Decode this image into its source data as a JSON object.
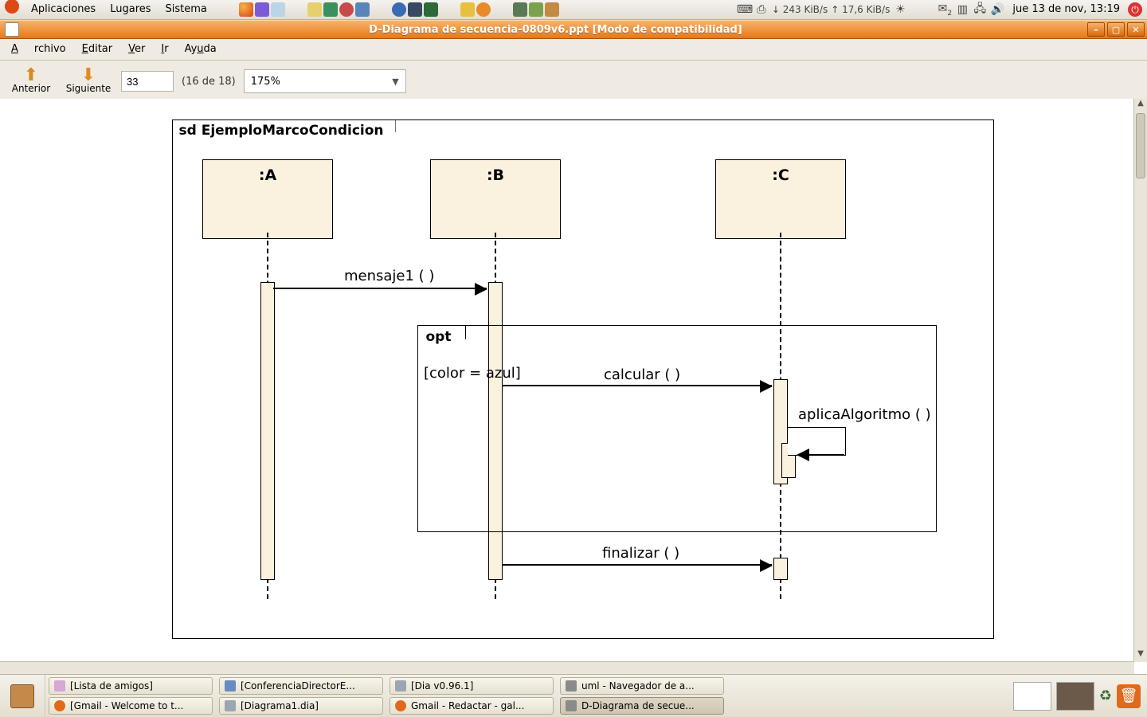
{
  "panel": {
    "menus": {
      "apps": "Aplicaciones",
      "places": "Lugares",
      "system": "Sistema"
    },
    "net_down": "↓ 243 KiB/s",
    "net_up": "↑ 17,6 KiB/s",
    "mail_badge": "2",
    "clock": "jue 13 de nov, 13:19"
  },
  "window": {
    "title": "D-Diagrama de secuencia-0809v6.ppt  [Modo de compatibilidad]"
  },
  "menus": {
    "file": "Archivo",
    "edit": "Editar",
    "view": "Ver",
    "go": "Ir",
    "help": "Ayuda"
  },
  "toolbar": {
    "prev": "Anterior",
    "next": "Siguiente",
    "page_value": "33",
    "page_of": "(16 de 18)",
    "zoom": "175%"
  },
  "diagram": {
    "frame_title": "sd  EjemploMarcoCondicion",
    "lifelines": {
      "a": ":A",
      "b": ":B",
      "c": ":C"
    },
    "messages": {
      "m1": "mensaje1 ( )",
      "calc": "calcular ( )",
      "algo": "aplicaAlgoritmo ( )",
      "fin": "finalizar ( )"
    },
    "opt_label": "opt",
    "opt_guard": "[color = azul]"
  },
  "tasks": {
    "t1": "[Lista de amigos]",
    "t2": "[Gmail - Welcome to t...",
    "t3": "[ConferenciaDirectorE...",
    "t4": "[Diagrama1.dia]",
    "t5": "[Dia v0.96.1]",
    "t6": "Gmail - Redactar - gal...",
    "t7": "uml - Navegador de a...",
    "t8": "D-Diagrama de secue..."
  }
}
